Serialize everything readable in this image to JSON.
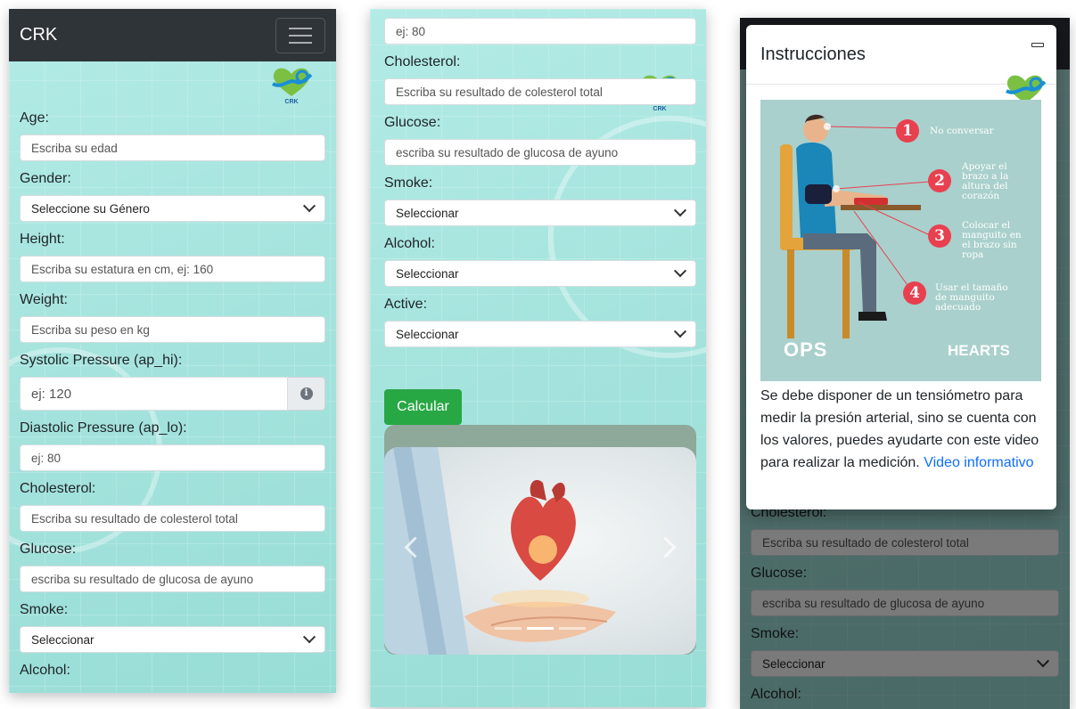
{
  "app": {
    "brand": "CRK",
    "logo_text": "CRK"
  },
  "labels": {
    "age": "Age:",
    "gender": "Gender:",
    "height": "Height:",
    "weight": "Weight:",
    "systolic": "Systolic Pressure (ap_hi):",
    "diastolic": "Diastolic Pressure (ap_lo):",
    "cholesterol": "Cholesterol:",
    "glucose": "Glucose:",
    "smoke": "Smoke:",
    "alcohol": "Alcohol:",
    "active": "Active:"
  },
  "placeholders": {
    "age": "Escriba su edad",
    "height": "Escriba su estatura en cm, ej: 160",
    "weight": "Escriba su peso en kg",
    "systolic": "ej: 120",
    "diastolic": "ej: 80",
    "cholesterol": "Escriba su resultado de colesterol total",
    "glucose": "escriba su resultado de glucosa de ayuno"
  },
  "selects": {
    "gender": "Seleccione su Género",
    "smoke": "Seleccionar",
    "alcohol": "Seleccionar",
    "active": "Seleccionar"
  },
  "buttons": {
    "calculate": "Calcular"
  },
  "carousel": {
    "slide_count": 3,
    "active_index": 1
  },
  "modal": {
    "title": "Instrucciones",
    "steps": [
      {
        "n": "1",
        "text": "No conversar"
      },
      {
        "n": "2",
        "text": "Apoyar el brazo a la altura del corazón"
      },
      {
        "n": "3",
        "text": "Colocar el manguito en el brazo sin ropa"
      },
      {
        "n": "4",
        "text": "Usar el tamaño de manguito adecuado"
      }
    ],
    "logo_left": "OPS",
    "logo_right": "HEARTS",
    "body_text": "Se debe disponer de un tensiómetro para medir la presión arterial, sino se cuenta con los valores, puedes ayudarte con este video para realizar la medición.",
    "link_text": "Video informativo"
  },
  "colors": {
    "navbar": "#2f3439",
    "accent_green": "#28a745",
    "link": "#0d6efd",
    "step_red": "#e8404f"
  }
}
